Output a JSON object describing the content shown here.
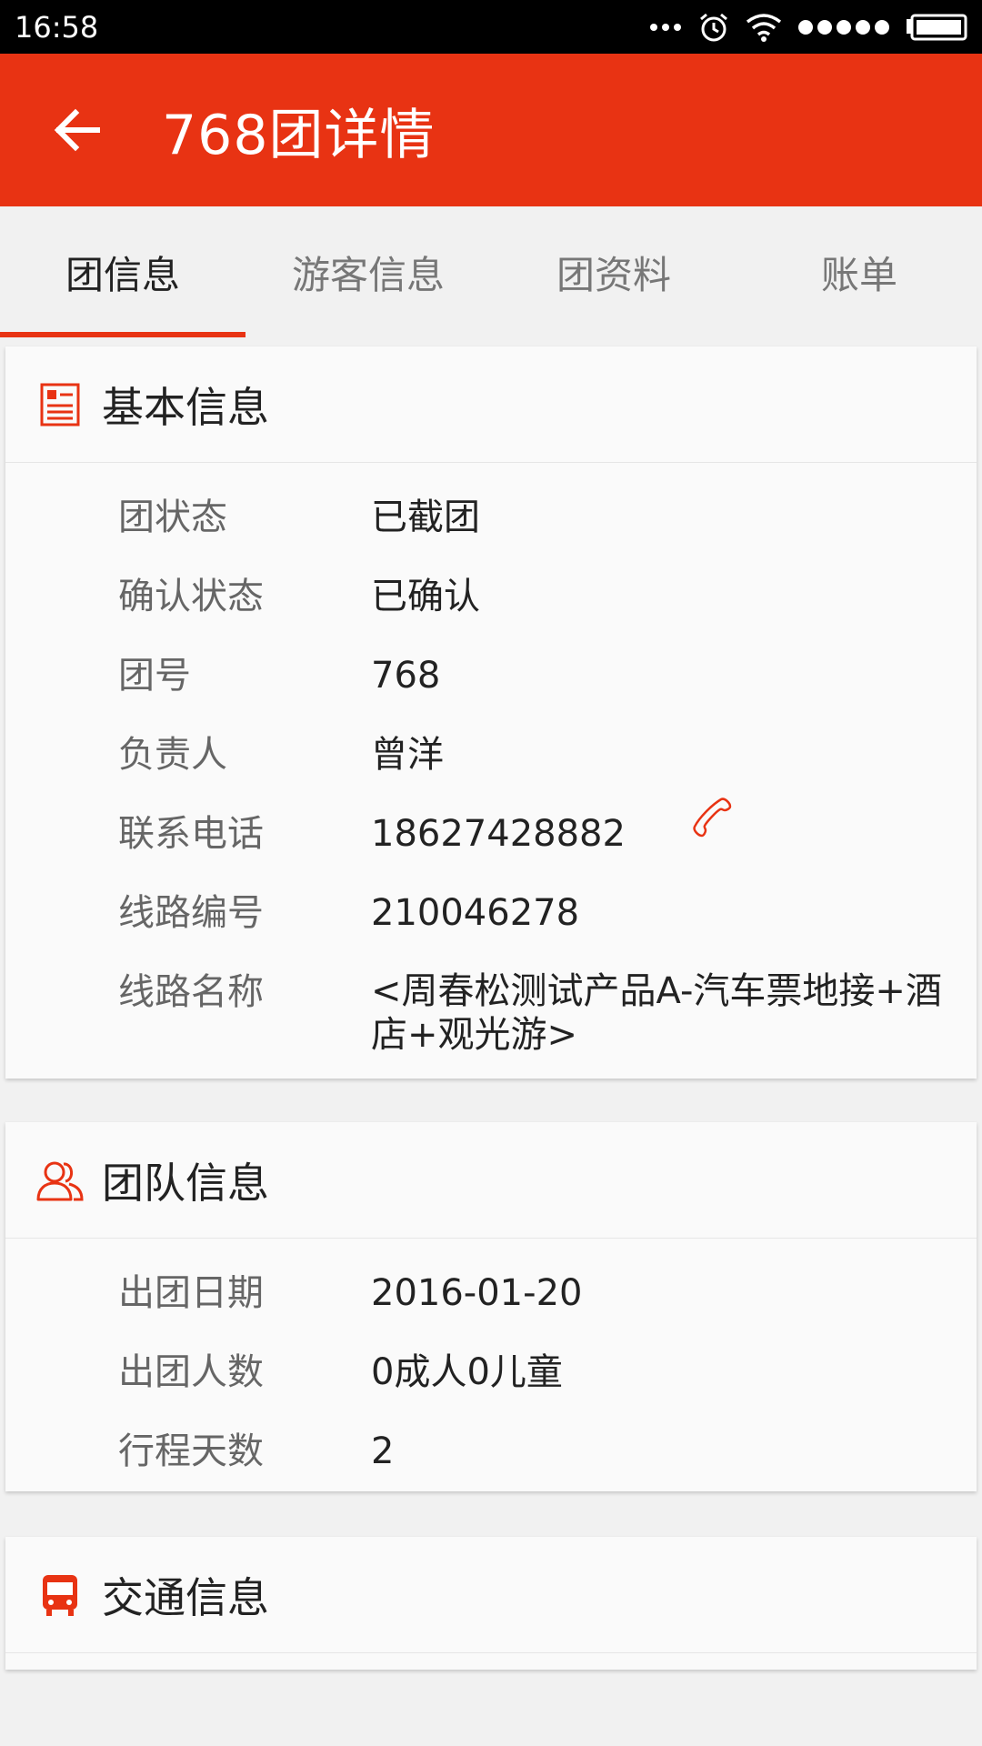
{
  "status_bar": {
    "time": "16:58"
  },
  "app_bar": {
    "title": "768团详情",
    "back_icon": "arrow-left-icon",
    "color": "#e83313"
  },
  "tabs": [
    {
      "label": "团信息",
      "active": true
    },
    {
      "label": "游客信息",
      "active": false
    },
    {
      "label": "团资料",
      "active": false
    },
    {
      "label": "账单",
      "active": false
    }
  ],
  "basic_info": {
    "title": "基本信息",
    "icon": "id-card-icon",
    "rows": [
      {
        "label": "团状态",
        "value": "已截团"
      },
      {
        "label": "确认状态",
        "value": "已确认"
      },
      {
        "label": "团号",
        "value": "768"
      },
      {
        "label": "负责人",
        "value": "曾洋"
      },
      {
        "label": "联系电话",
        "value": "18627428882"
      },
      {
        "label": "线路编号",
        "value": "210046278"
      },
      {
        "label": "线路名称",
        "value": "<周春松测试产品A-汽车票地接+酒店+观光游>"
      }
    ]
  },
  "team_info": {
    "title": "团队信息",
    "icon": "group-icon",
    "rows": [
      {
        "label": "出团日期",
        "value": "2016-01-20"
      },
      {
        "label": "出团人数",
        "value": "0成人0儿童"
      },
      {
        "label": "行程天数",
        "value": "2"
      }
    ]
  },
  "traffic_info": {
    "title": "交通信息",
    "icon": "bus-icon"
  },
  "colors": {
    "accent": "#e83313",
    "background": "#f1f1f1",
    "card": "#fafafa"
  }
}
